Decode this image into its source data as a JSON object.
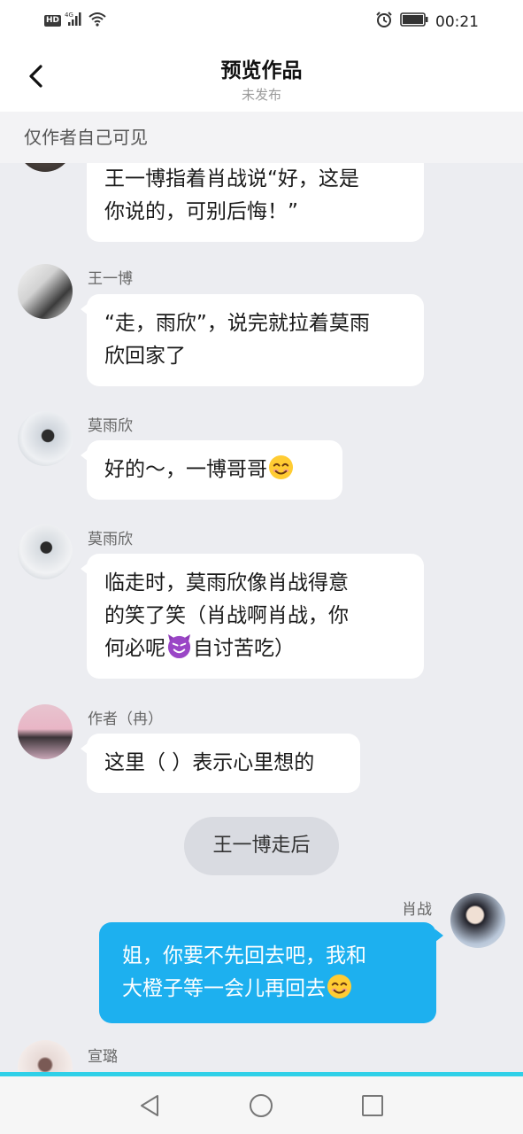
{
  "status_bar": {
    "hd": "HD",
    "network": "4G",
    "time": "00:21"
  },
  "header": {
    "title": "预览作品",
    "subtitle": "未发布"
  },
  "notice": "仅作者自己可见",
  "messages": [
    {
      "text_lines": [
        "王一博指着肖战说“好，这是",
        "你说的，可别后悔！”"
      ]
    },
    {
      "sender": "王一博",
      "text_lines": [
        "“走，雨欣”，说完就拉着莫雨",
        "欣回家了"
      ]
    },
    {
      "sender": "莫雨欣",
      "text": "好的～，一博哥哥",
      "emoji": "smiling-face-emoji"
    },
    {
      "sender": "莫雨欣",
      "text_lines": [
        "临走时，莫雨欣像肖战得意",
        "的笑了笑（肖战啊肖战，你"
      ],
      "line3_before": "何必呢",
      "emoji": "smiling-devil-emoji",
      "line3_after": "自讨苦吃）"
    },
    {
      "sender": "作者（冉）",
      "text": "这里（ ）表示心里想的"
    },
    {
      "system": "王一博走后"
    },
    {
      "sender": "肖战",
      "text_lines": [
        "姐，你要不先回去吧，我和",
        "大橙子等一会儿再回去"
      ],
      "emoji": "smiling-face-emoji"
    },
    {
      "sender": "宣璐"
    }
  ],
  "colors": {
    "my_bubble": "#1db0ef",
    "accent_line": "#2fd0e8",
    "background": "#ecedf1"
  }
}
